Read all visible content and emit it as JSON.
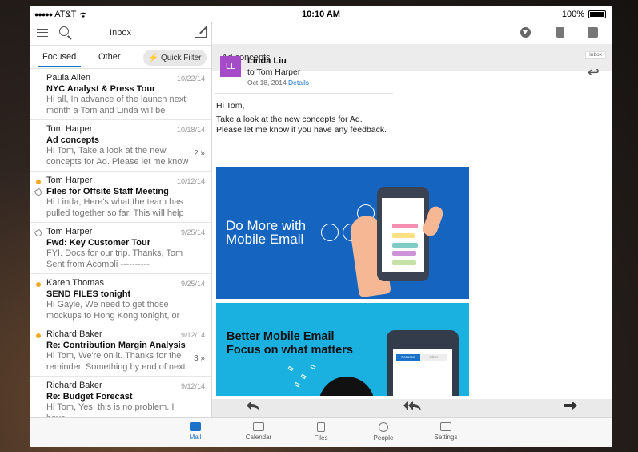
{
  "status_bar": {
    "carrier": "AT&T",
    "time": "10:10 AM",
    "battery": "100%"
  },
  "left_pane": {
    "title": "Inbox",
    "tabs": {
      "focused": "Focused",
      "other": "Other"
    },
    "quick_filter": "Quick Filter",
    "messages": [
      {
        "from": "Paula Allen",
        "date": "10/22/14",
        "subject": "NYC Analyst & Press Tour",
        "preview": "Hi all, In advance of the launch next month a Tom and Linda will be",
        "count": "",
        "unread": false,
        "attachment": false
      },
      {
        "from": "Tom Harper",
        "date": "10/18/14",
        "subject": "Ad concepts",
        "preview": "Hi Tom, Take a look at the new concepts for Ad. Please let me know",
        "count": "2 »",
        "unread": false,
        "attachment": false
      },
      {
        "from": "Tom Harper",
        "date": "10/12/14",
        "subject": "Files for Offsite Staff Meeting",
        "preview": "Hi Linda, Here's what the team has pulled together so far. This will help",
        "count": "",
        "unread": true,
        "attachment": true
      },
      {
        "from": "Tom Harper",
        "date": "9/25/14",
        "subject": "Fwd: Key Customer Tour",
        "preview": "FYI. Docs for our trip. Thanks, Tom Sent from Acompli ----------",
        "count": "",
        "unread": false,
        "attachment": true
      },
      {
        "from": "Karen Thomas",
        "date": "9/25/14",
        "subject": "SEND FILES tonight",
        "preview": "Hi Gayle, We need to get those mockups to Hong Kong tonight, or",
        "count": "",
        "unread": true,
        "attachment": false
      },
      {
        "from": "Richard Baker",
        "date": "9/12/14",
        "subject": "Re: Contribution Margin Analysis",
        "preview": "Hi Tom, We're on it. Thanks for the reminder. Something by end of next",
        "count": "3 »",
        "unread": true,
        "attachment": false
      },
      {
        "from": "Richard Baker",
        "date": "9/12/14",
        "subject": "Re: Budget Forecast",
        "preview": "Hi Tom, Yes, this is no problem. I have",
        "count": "",
        "unread": false,
        "attachment": false
      }
    ]
  },
  "reading_pane": {
    "subject": "Ad concepts",
    "folder_tag": "Inbox",
    "avatar_initials": "LL",
    "sender": "Linda Liu",
    "to": "to Tom Harper",
    "date": "Oct 18, 2014",
    "details_link": "Details",
    "body": {
      "greeting": "Hi Tom,",
      "line1": "Take a look at the new concepts for Ad.",
      "line2": "Please let me know if you have any feedback."
    },
    "promo1": {
      "line1": "Do More with",
      "line2": "Mobile Email",
      "bg": "#1565c0"
    },
    "promo2": {
      "line1": "Better Mobile Email",
      "line2": "Focus on what matters",
      "tab_focused": "Focused",
      "tab_other": "Other",
      "bg": "#1ab0e0"
    }
  },
  "tab_bar": {
    "items": [
      {
        "label": "Mail",
        "icon": "mail-icon"
      },
      {
        "label": "Calendar",
        "icon": "calendar-icon"
      },
      {
        "label": "Files",
        "icon": "files-icon"
      },
      {
        "label": "People",
        "icon": "people-icon"
      },
      {
        "label": "Settings",
        "icon": "settings-icon"
      }
    ]
  },
  "colors": {
    "accent": "#1a73c9",
    "avatar": "#a64bc7",
    "unread_dot": "#f5a623"
  }
}
